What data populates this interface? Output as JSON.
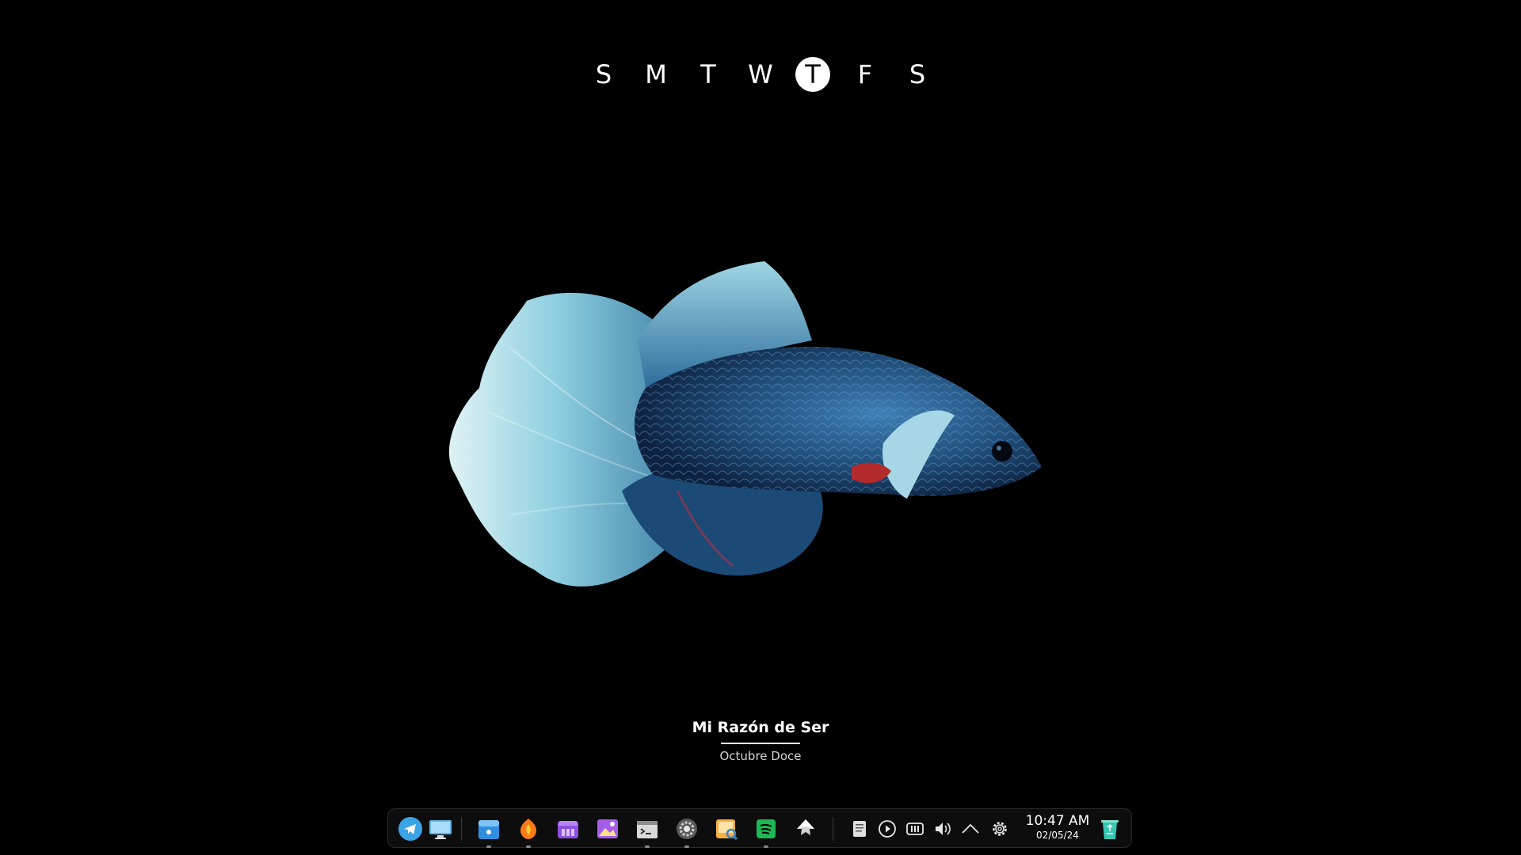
{
  "weekdays": {
    "days": [
      "S",
      "M",
      "T",
      "W",
      "T",
      "F",
      "S"
    ],
    "active_index": 4
  },
  "now_playing": {
    "title": "Mi Razón de Ser",
    "artist": "Octubre Doce"
  },
  "dock": {
    "apps": [
      {
        "icon": "telegram-icon",
        "running": false
      },
      {
        "icon": "desktop-icon",
        "running": false
      },
      {
        "icon": "file-manager-icon",
        "running": true
      },
      {
        "icon": "firefox-icon",
        "running": true
      },
      {
        "icon": "app-store-icon",
        "running": false
      },
      {
        "icon": "image-viewer-icon",
        "running": false
      },
      {
        "icon": "terminal-icon",
        "running": true
      },
      {
        "icon": "settings-app-icon",
        "running": true
      },
      {
        "icon": "image-search-icon",
        "running": false
      },
      {
        "icon": "spotify-icon",
        "running": true
      },
      {
        "icon": "inkscape-icon",
        "running": false
      }
    ],
    "tray": [
      "clipboard-icon",
      "media-play-icon",
      "memory-icon",
      "volume-icon",
      "chevron-up-icon",
      "gear-icon"
    ],
    "clock": {
      "time": "10:47 AM",
      "date": "02/05/24"
    },
    "trash": "recycle-bin-icon"
  },
  "colors": {
    "background": "#000000",
    "active_day_bg": "#ffffff",
    "fish_body": "#2c5f8f",
    "fish_fin": "#8fd0e0"
  }
}
